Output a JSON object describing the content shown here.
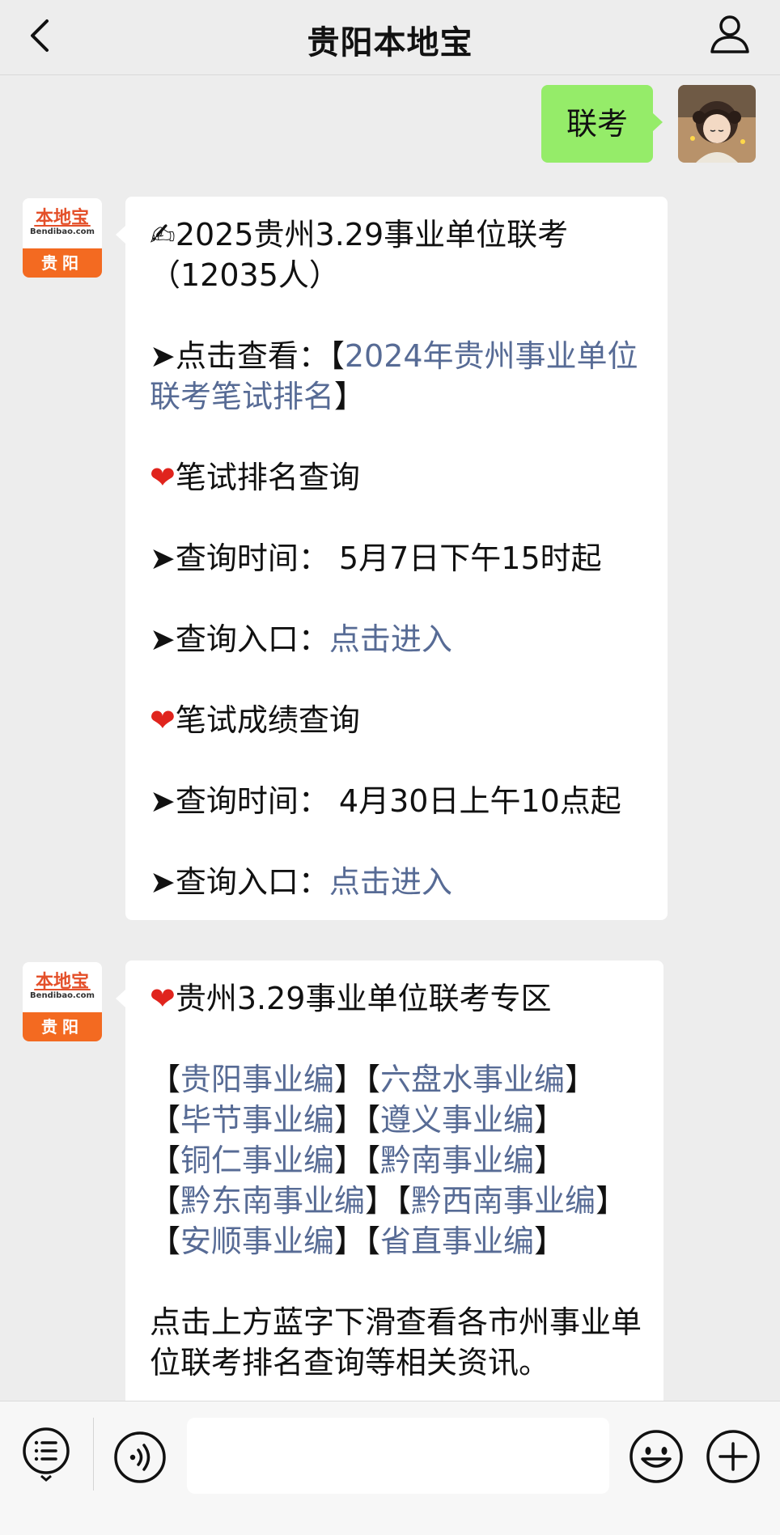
{
  "header": {
    "title": "贵阳本地宝",
    "back_icon": "chevron-left-icon",
    "profile_icon": "person-icon"
  },
  "outgoing_message": {
    "text": "联考"
  },
  "account": {
    "logo_text": "本地宝",
    "logo_sub": "Bendibao.com",
    "logo_city": "贵阳"
  },
  "message1": {
    "line1": "✍2025贵州3.29事业单位联考（12035人）",
    "view_prefix": "➤点击查看：【",
    "view_link": "2024年贵州事业单位联考笔试排名",
    "view_suffix": "】",
    "rank_heart": "❤",
    "rank_title": "笔试排名查询",
    "rank_time": "➤查询时间：  5月7日下午15时起",
    "rank_entry_label": "➤查询入口：",
    "rank_entry_link": "点击进入",
    "score_heart": "❤",
    "score_title": "笔试成绩查询",
    "score_time": "➤查询时间：  4月30日上午10点起",
    "score_entry_label": "➤查询入口：",
    "score_entry_link": "点击进入"
  },
  "message2": {
    "heart": "❤",
    "title": "贵州3.29事业单位联考专区",
    "links": [
      "贵阳事业编",
      "六盘水事业编",
      "毕节事业编",
      "遵义事业编",
      "铜仁事业编",
      "黔南事业编",
      "黔东南事业编",
      "黔西南事业编",
      "安顺事业编",
      "省直事业编"
    ],
    "note": "点击上方蓝字下滑查看各市州事业单位联考排名查询等相关资讯。"
  },
  "bottombar": {
    "menu_icon": "menu-list-icon",
    "voice_icon": "voice-icon",
    "emoji_icon": "emoji-icon",
    "plus_icon": "plus-icon",
    "input_value": ""
  },
  "colors": {
    "link": "#576b95",
    "outgoing_bubble": "#95ec69",
    "background": "#ededed",
    "heart": "#e0241d",
    "logo_orange": "#f36a21"
  }
}
